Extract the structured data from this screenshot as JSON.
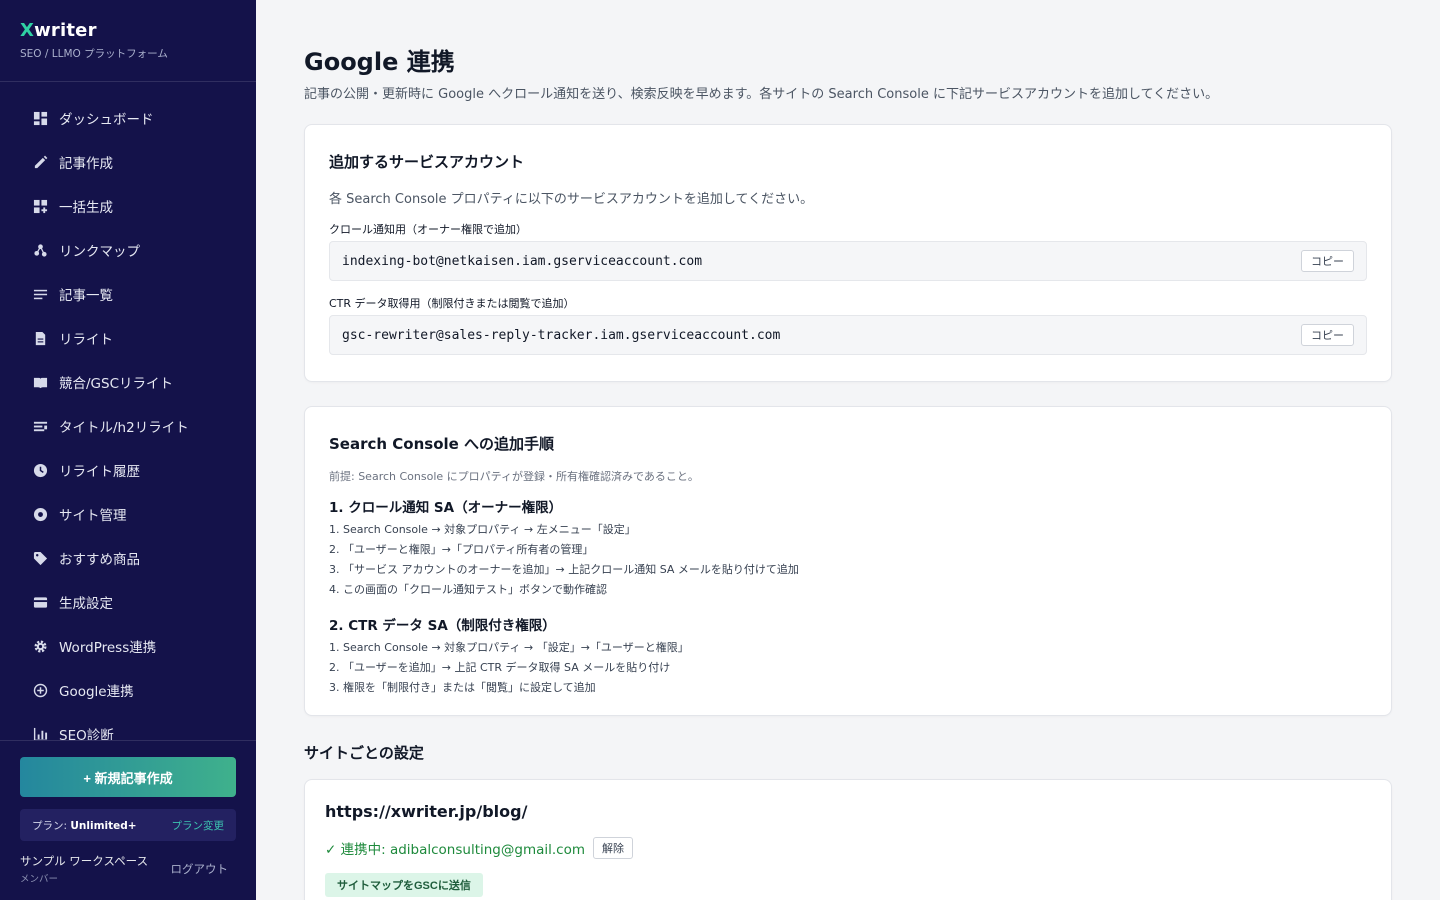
{
  "brand": {
    "logo_x": "X",
    "logo_rest": "writer",
    "subtitle": "SEO / LLMO プラットフォーム"
  },
  "sidebar": {
    "items": [
      {
        "label": "ダッシュボード",
        "icon": "dashboard-icon"
      },
      {
        "label": "記事作成",
        "icon": "pencil-icon"
      },
      {
        "label": "一括生成",
        "icon": "grid-add-icon"
      },
      {
        "label": "リンクマップ",
        "icon": "link-map-icon"
      },
      {
        "label": "記事一覧",
        "icon": "list-icon"
      },
      {
        "label": "リライト",
        "icon": "document-icon"
      },
      {
        "label": "競合/GSCリライト",
        "icon": "book-icon"
      },
      {
        "label": "タイトル/h2リライト",
        "icon": "title-icon"
      },
      {
        "label": "リライト履歴",
        "icon": "clock-icon"
      },
      {
        "label": "サイト管理",
        "icon": "site-icon"
      },
      {
        "label": "おすすめ商品",
        "icon": "tag-icon"
      },
      {
        "label": "生成設定",
        "icon": "card-icon"
      },
      {
        "label": "WordPress連携",
        "icon": "gear-icon"
      },
      {
        "label": "Google連携",
        "icon": "plus-circle-icon"
      },
      {
        "label": "SEO診断",
        "icon": "chart-icon"
      }
    ],
    "new_article_label": "+ 新規記事作成",
    "plan_prefix": "プラン: ",
    "plan_name": "Unlimited+",
    "plan_change": "プラン変更",
    "workspace_name": "サンプル ワークスペース",
    "workspace_role": "メンバー",
    "logout": "ログアウト"
  },
  "main": {
    "title": "Google 連携",
    "description": "記事の公開・更新時に Google へクロール通知を送り、検索反映を早めます。各サイトの Search Console に下記サービスアカウントを追加してください。",
    "service_card": {
      "title": "追加するサービスアカウント",
      "description": "各 Search Console プロパティに以下のサービスアカウントを追加してください。",
      "crawl_label": "クロール通知用（オーナー権限で追加）",
      "crawl_email": "indexing-bot@netkaisen.iam.gserviceaccount.com",
      "ctr_label": "CTR データ取得用（制限付きまたは閲覧で追加）",
      "ctr_email": "gsc-rewriter@sales-reply-tracker.iam.gserviceaccount.com",
      "copy_label": "コピー"
    },
    "steps_card": {
      "title": "Search Console への追加手順",
      "prerequisite": "前提: Search Console にプロパティが登録・所有権確認済みであること。",
      "section1_title": "1. クロール通知 SA（オーナー権限）",
      "section1_steps": [
        "1. Search Console → 対象プロパティ → 左メニュー「設定」",
        "2. 「ユーザーと権限」→「プロパティ所有者の管理」",
        "3. 「サービス アカウントのオーナーを追加」→ 上記クロール通知 SA メールを貼り付けて追加",
        "4. この画面の「クロール通知テスト」ボタンで動作確認"
      ],
      "section2_title": "2. CTR データ SA（制限付き権限）",
      "section2_steps": [
        "1. Search Console → 対象プロパティ → 「設定」→「ユーザーと権限」",
        "2. 「ユーザーを追加」→ 上記 CTR データ取得 SA メールを貼り付け",
        "3. 権限を「制限付き」または「閲覧」に設定して追加"
      ]
    },
    "site_section_title": "サイトごとの設定",
    "site": {
      "url": "https://xwriter.jp/blog/",
      "status": "✓ 連携中: adibalconsulting@gmail.com",
      "unlink_label": "解除",
      "sitemap_label": "サイトマップをGSCに送信"
    }
  },
  "colors": {
    "sidebar_bg": "#14124a",
    "accent_teal": "#2fd1a3",
    "linked_green": "#1e8a3c"
  }
}
